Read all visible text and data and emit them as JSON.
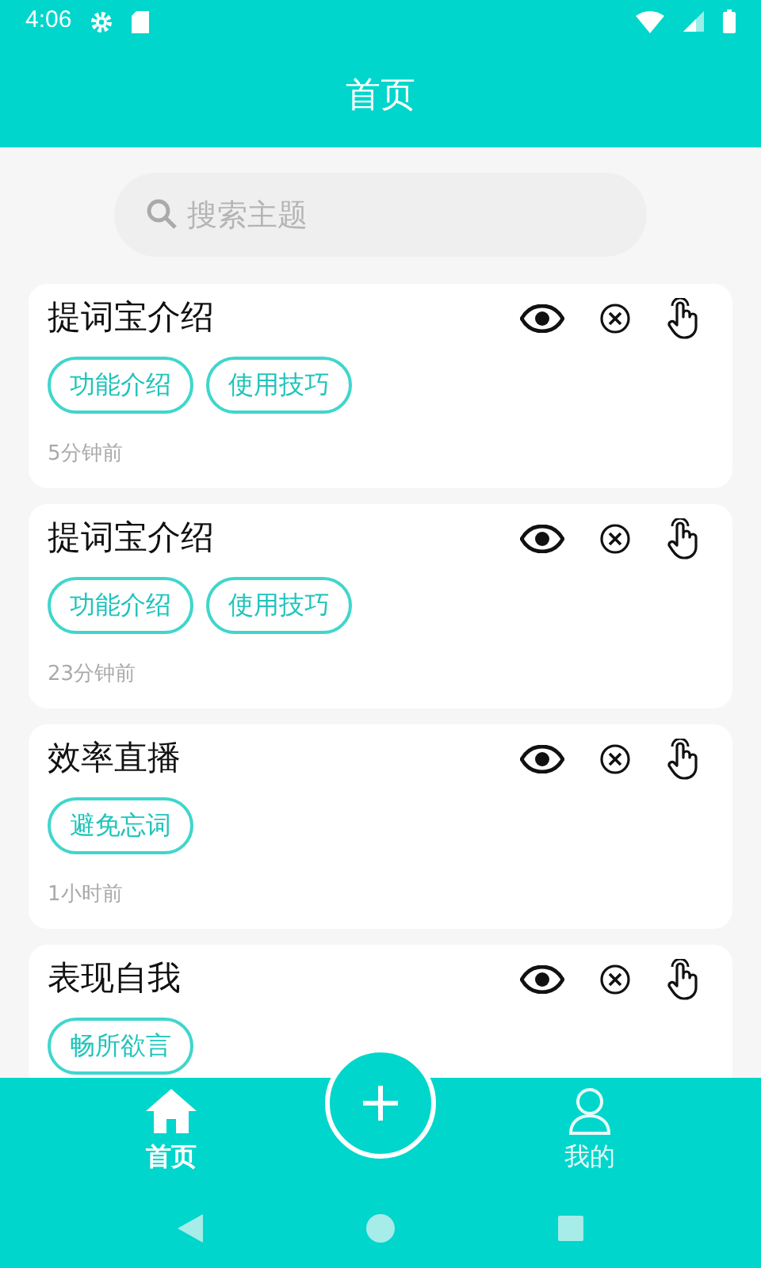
{
  "status_bar": {
    "time": "4:06"
  },
  "header": {
    "title": "首页"
  },
  "search": {
    "placeholder": "搜索主题"
  },
  "cards": [
    {
      "title": "提词宝介绍",
      "tags": [
        "功能介绍",
        "使用技巧"
      ],
      "time": "5分钟前"
    },
    {
      "title": "提词宝介绍",
      "tags": [
        "功能介绍",
        "使用技巧"
      ],
      "time": "23分钟前"
    },
    {
      "title": "效率直播",
      "tags": [
        "避免忘词"
      ],
      "time": "1小时前"
    },
    {
      "title": "表现自我",
      "tags": [
        "畅所欲言"
      ]
    }
  ],
  "bottom_tabs": [
    {
      "label": "首页",
      "kind": "home",
      "selected": true
    },
    {
      "label": "我的",
      "kind": "user",
      "selected": false
    }
  ]
}
